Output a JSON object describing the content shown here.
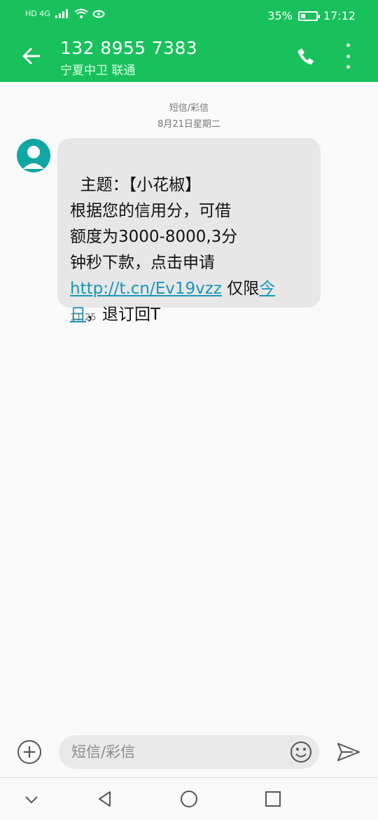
{
  "status_bar": {
    "network_labels": "HD 4G",
    "battery_percent": "35%",
    "time": "17:12"
  },
  "header": {
    "contact_number": "132 8955 7383",
    "contact_location": "宁夏中卫 联通"
  },
  "conversation": {
    "message_type": "短信/彩信",
    "date": "8月21日星期二",
    "message": {
      "text_1": "主题：【小花椒】\n根据您的信用分，可借\n额度为3000-8000,3分\n钟秒下款，点击申请\n",
      "link": "http://t.cn/Ev19vzz",
      "text_2": " 仅限",
      "link_2": "今\n日",
      "text_3": "，退订回T",
      "time": "11:25"
    }
  },
  "composer": {
    "placeholder": "短信/彩信"
  },
  "colors": {
    "header_green": "#19c15c",
    "bubble_gray": "#e7e7e7",
    "link_blue": "#1597b8"
  },
  "icons": [
    "back-arrow-icon",
    "phone-icon",
    "more-options-icon",
    "contact-avatar-icon",
    "add-icon",
    "emoji-icon",
    "send-icon",
    "nav-down-icon",
    "nav-back-icon",
    "nav-home-icon",
    "nav-recent-icon"
  ]
}
